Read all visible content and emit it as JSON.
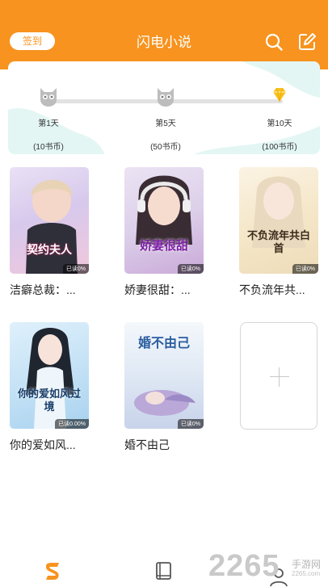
{
  "header": {
    "checkin_label": "签到",
    "title": "闪电小说",
    "search_icon": "search-icon",
    "edit_icon": "edit-icon"
  },
  "colors": {
    "accent": "#f7931e",
    "background": "#ffffff",
    "wave": "#e3f6f4"
  },
  "checkin": {
    "milestones": [
      {
        "day": "第1天",
        "reward": "(10书币)",
        "icon": "owl-icon"
      },
      {
        "day": "第5天",
        "reward": "(50书币)",
        "icon": "owl-icon"
      },
      {
        "day": "第10天",
        "reward": "(100书币)",
        "icon": "diamond-icon"
      }
    ]
  },
  "books": [
    {
      "title": "洁癖总裁：...",
      "badge": "已读0%",
      "cover_text": "契约夫人"
    },
    {
      "title": "娇妻很甜：...",
      "badge": "已读0%",
      "cover_text": "娇妻很甜"
    },
    {
      "title": "不负流年共...",
      "badge": "已读0%",
      "cover_text": "不负流年共白首"
    },
    {
      "title": "你的爱如风...",
      "badge": "已读0.00%",
      "cover_text": "你的爱如风过境"
    },
    {
      "title": "婚不由己",
      "badge": "已读0%",
      "cover_text": "婚不由己"
    }
  ],
  "add_card": {
    "icon": "plus-icon"
  },
  "bottom_nav": [
    {
      "name": "bookstore",
      "icon": "lightning-icon"
    },
    {
      "name": "bookshelf",
      "icon": "book-icon"
    },
    {
      "name": "profile",
      "icon": "user-icon"
    }
  ],
  "watermark": {
    "number": "2265",
    "cn": "手游网",
    "en": "2265.com"
  }
}
